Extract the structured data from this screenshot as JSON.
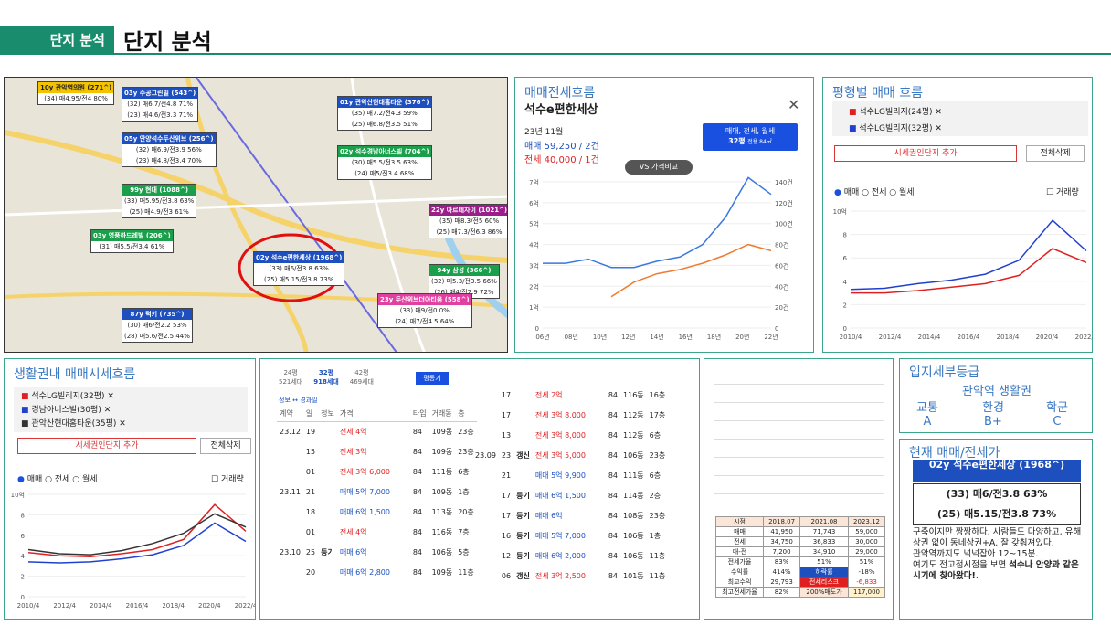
{
  "header": {
    "tag": "단지 분석",
    "title": "단지 분석"
  },
  "map": {
    "boxes": [
      {
        "h": "10y 관악역의원 (271^)",
        "c": "#f4c300",
        "tc": "#222",
        "rows": [
          "(34) 매4.95/전4 80%"
        ]
      },
      {
        "h": "03y 주공그린빌 (543^)",
        "c": "#1e4fbf",
        "rows": [
          "(32) 매6.7/전4.8 71%",
          "(23) 매4.6/전3.3 71%"
        ]
      },
      {
        "h": "01y 관악산현대홈타운 (376^)",
        "c": "#1e4fbf",
        "rows": [
          "(35) 매7.2/전4.3 59%",
          "(25) 매6.8/전3.5 51%"
        ]
      },
      {
        "h": "05y 안양석수두산위브 (256^)",
        "c": "#1e4fbf",
        "rows": [
          "(32) 매6.9/전3.9 56%",
          "(23) 매4.8/전3.4 70%"
        ]
      },
      {
        "h": "02y 석수경남아너스빌 (704^)",
        "c": "#1aa04a",
        "rows": [
          "(30) 매5.5/전3.5 63%",
          "(24) 매5/전3.4 68%"
        ]
      },
      {
        "h": "99y 현대 (1088^)",
        "c": "#1aa04a",
        "rows": [
          "(33) 매5.95/전3.8 63%",
          "(25) 매4.9/전3 61%"
        ]
      },
      {
        "h": "22y 아르테자이 (1021^)",
        "c": "#9a1f8a",
        "rows": [
          "(35) 매8.3/전5 60%",
          "(25) 매7.3/전6.3 86%"
        ]
      },
      {
        "h": "03y 영풍하드레빌 (206^)",
        "c": "#1aa04a",
        "rows": [
          "(31) 매5.5/전3.4 61%"
        ]
      },
      {
        "h": "02y 석수e편한세상 (1968^)",
        "c": "#1e4fbf",
        "rows": [
          "(33) 매6/전3.8 63%",
          "(25) 매5.15/전3.8 73%"
        ]
      },
      {
        "h": "94y 삼성 (366^)",
        "c": "#1aa04a",
        "rows": [
          "(32) 매5.3/전3.5 66%",
          "(26) 매4/전2.9 72%"
        ]
      },
      {
        "h": "23y 두산위브더아티움 (558^)",
        "c": "#e040a0",
        "rows": [
          "(33) 매9/전0 0%",
          "(24) 매7/전4.5 64%"
        ]
      },
      {
        "h": "87y 럭키 (735^)",
        "c": "#1e4fbf",
        "rows": [
          "(30) 매6/전2.2 53%",
          "(28) 매5.6/전2.5 44%"
        ]
      }
    ]
  },
  "price_flow": {
    "title": "매매전세흐름",
    "apt": "석수e편한세상",
    "date": "23년 11월",
    "sale": "매매 59,250 / 2건",
    "jeonse": "전세 40,000 / 1건",
    "type_btn": "매매, 전세, 월세",
    "size": "32평",
    "size_sub": "전용 84㎡",
    "vs": "VS 가격비교",
    "chart_data": {
      "type": "line",
      "x": [
        "06년",
        "08년",
        "10년",
        "12년",
        "14년",
        "16년",
        "18년",
        "20년",
        "22년"
      ],
      "yticks": [
        "0",
        "1억",
        "2억",
        "3억",
        "4억",
        "5억",
        "6억",
        "7억"
      ],
      "y2ticks": [
        "0",
        "20건",
        "40건",
        "60건",
        "80건",
        "100건",
        "120건",
        "140건"
      ],
      "series": [
        {
          "color": "#3a78e0",
          "values": [
            3.1,
            3.1,
            3.3,
            2.9,
            2.9,
            3.2,
            3.4,
            4.0,
            5.3,
            7.2,
            6.4
          ]
        },
        {
          "color": "#f07a30",
          "values": [
            null,
            null,
            null,
            1.5,
            2.2,
            2.6,
            2.8,
            3.1,
            3.5,
            4.0,
            3.7
          ]
        }
      ]
    }
  },
  "size_flow": {
    "title": "평형별 매매 흐름",
    "legend": [
      "석수LG빌리지(24평)",
      "석수LG빌리지(32평)"
    ],
    "add_btn": "시세권인단지 추가",
    "del_btn": "전체삭제",
    "radios": [
      "매매",
      "전세",
      "월세"
    ],
    "check": "거래량",
    "chart_data": {
      "type": "line",
      "x": [
        "2010/4",
        "2012/4",
        "2014/4",
        "2016/4",
        "2018/4",
        "2020/4",
        "2022/4"
      ],
      "yticks": [
        "0",
        "2",
        "4",
        "6",
        "8",
        "10억"
      ],
      "series": [
        {
          "name": "석수LG빌리지(24평)",
          "color": "#e02020",
          "values": [
            3.0,
            3.0,
            3.2,
            3.5,
            3.8,
            4.5,
            6.8,
            5.6
          ]
        },
        {
          "name": "석수LG빌리지(32평)",
          "color": "#2040d0",
          "values": [
            3.3,
            3.4,
            3.8,
            4.1,
            4.6,
            5.8,
            9.2,
            6.6
          ]
        }
      ]
    }
  },
  "region_flow": {
    "title": "생활권내 매매시세흐름",
    "legend": [
      "석수LG빌리지(32평)",
      "경남아너스빌(30평)",
      "관악산현대홈타운(35평)"
    ],
    "add_btn": "시세권인단지 추가",
    "del_btn": "전체삭제",
    "radios": [
      "매매",
      "전세",
      "월세"
    ],
    "check": "거래량",
    "chart_data": {
      "type": "line",
      "x": [
        "2010/4",
        "2012/4",
        "2014/4",
        "2016/4",
        "2018/4",
        "2020/4",
        "2022/4"
      ],
      "yticks": [
        "0",
        "2",
        "4",
        "6",
        "8",
        "10억"
      ],
      "series": [
        {
          "name": "석수LG빌리지(32평)",
          "color": "#e02020",
          "values": [
            4.3,
            4.0,
            3.9,
            4.2,
            4.6,
            5.6,
            9.0,
            6.4
          ]
        },
        {
          "name": "경남아너스빌(30평)",
          "color": "#2040d0",
          "values": [
            3.4,
            3.3,
            3.4,
            3.7,
            4.1,
            5.0,
            7.2,
            5.4
          ]
        },
        {
          "name": "관악산현대홈타운(35평)",
          "color": "#333",
          "values": [
            4.6,
            4.2,
            4.1,
            4.5,
            5.2,
            6.2,
            8.1,
            6.8
          ]
        }
      ]
    }
  },
  "trades": {
    "tabs": [
      [
        "24평",
        "521세대"
      ],
      [
        "32평",
        "918세대"
      ],
      [
        "42평",
        "469세대"
      ]
    ],
    "btn": "평통기",
    "info": "정보 ↔ 경과일",
    "head": [
      "계약",
      "일",
      "정보",
      "가격",
      "타입",
      "거래동",
      "층"
    ],
    "left": [
      [
        "23.12",
        "19",
        "",
        "전세 4억",
        "84",
        "109동",
        "23층"
      ],
      [
        "",
        "15",
        "",
        "전세 3억",
        "84",
        "109동",
        "23층"
      ],
      [
        "",
        "01",
        "",
        "전세 3억 6,000",
        "84",
        "111동",
        "6층"
      ],
      [
        "23.11",
        "21",
        "",
        "매매 5억 7,000",
        "84",
        "109동",
        "1층"
      ],
      [
        "",
        "18",
        "",
        "매매 6억 1,500",
        "84",
        "113동",
        "20층"
      ],
      [
        "",
        "01",
        "",
        "전세 4억",
        "84",
        "116동",
        "7층"
      ],
      [
        "23.10",
        "25",
        "등기",
        "매매 6억",
        "84",
        "106동",
        "5층"
      ],
      [
        "",
        "20",
        "",
        "매매 6억 2,800",
        "84",
        "109동",
        "11층"
      ]
    ],
    "right": [
      [
        "",
        "17",
        "",
        "전세 2억",
        "84",
        "116동",
        "16층"
      ],
      [
        "",
        "17",
        "",
        "전세 3억 8,000",
        "84",
        "112동",
        "17층"
      ],
      [
        "",
        "13",
        "",
        "전세 3억 8,000",
        "84",
        "112동",
        "6층"
      ],
      [
        "23.09",
        "23",
        "갱신",
        "전세 3억 5,000",
        "84",
        "106동",
        "23층"
      ],
      [
        "",
        "21",
        "",
        "매매 5억 9,900",
        "84",
        "111동",
        "6층"
      ],
      [
        "",
        "17",
        "등기",
        "매매 6억 1,500",
        "84",
        "114동",
        "2층"
      ],
      [
        "",
        "17",
        "등기",
        "매매 6억",
        "84",
        "108동",
        "23층"
      ],
      [
        "",
        "16",
        "등기",
        "매매 5억 7,000",
        "84",
        "106동",
        "1층"
      ],
      [
        "",
        "12",
        "등기",
        "매매 6억 2,000",
        "84",
        "106동",
        "11층"
      ],
      [
        "",
        "06",
        "갱신",
        "전세 3억 2,500",
        "84",
        "101동",
        "11층"
      ]
    ]
  },
  "summary": {
    "head": [
      "시점",
      "2018.07",
      "2021.08",
      "2023.12"
    ],
    "rows": [
      [
        "매매",
        "41,950",
        "71,743",
        "59,000"
      ],
      [
        "전세",
        "34,750",
        "36,833",
        "30,000"
      ],
      [
        "매-전",
        "7,200",
        "34,910",
        "29,000"
      ],
      [
        "전세가율",
        "83%",
        "51%",
        "51%"
      ],
      [
        "수익률",
        "414%",
        "하락률",
        "-18%"
      ],
      [
        "최고수익",
        "29,793",
        "전세리스크",
        "-6,833"
      ],
      [
        "최고전세가율",
        "82%",
        "200%매도가",
        "117,000"
      ]
    ]
  },
  "grade": {
    "title": "입지세부등급",
    "sub": "관악역 생활권",
    "cols": [
      "교통",
      "환경",
      "학군"
    ],
    "vals": [
      "A",
      "B+",
      "C"
    ]
  },
  "current": {
    "title": "현재 매매/전세가",
    "h": "02y 석수e편한세상 (1968^)",
    "r1": "(33) 매6/전3.8 63%",
    "r2": "(25) 매5.15/전3.8 73%",
    "p1": "구축이지만 짱짱하다. 사람들도 다양하고, 유해상권 없이 동네상권+A. 잘 갖춰져있다.",
    "p2": "관악역까지도 넉넉잡아 12~15분.",
    "p3": "여기도 전고점시점을 보면 ",
    "p3b": "석수나 안양과 같은 시기에 찾아왔다!",
    "p3e": "."
  }
}
